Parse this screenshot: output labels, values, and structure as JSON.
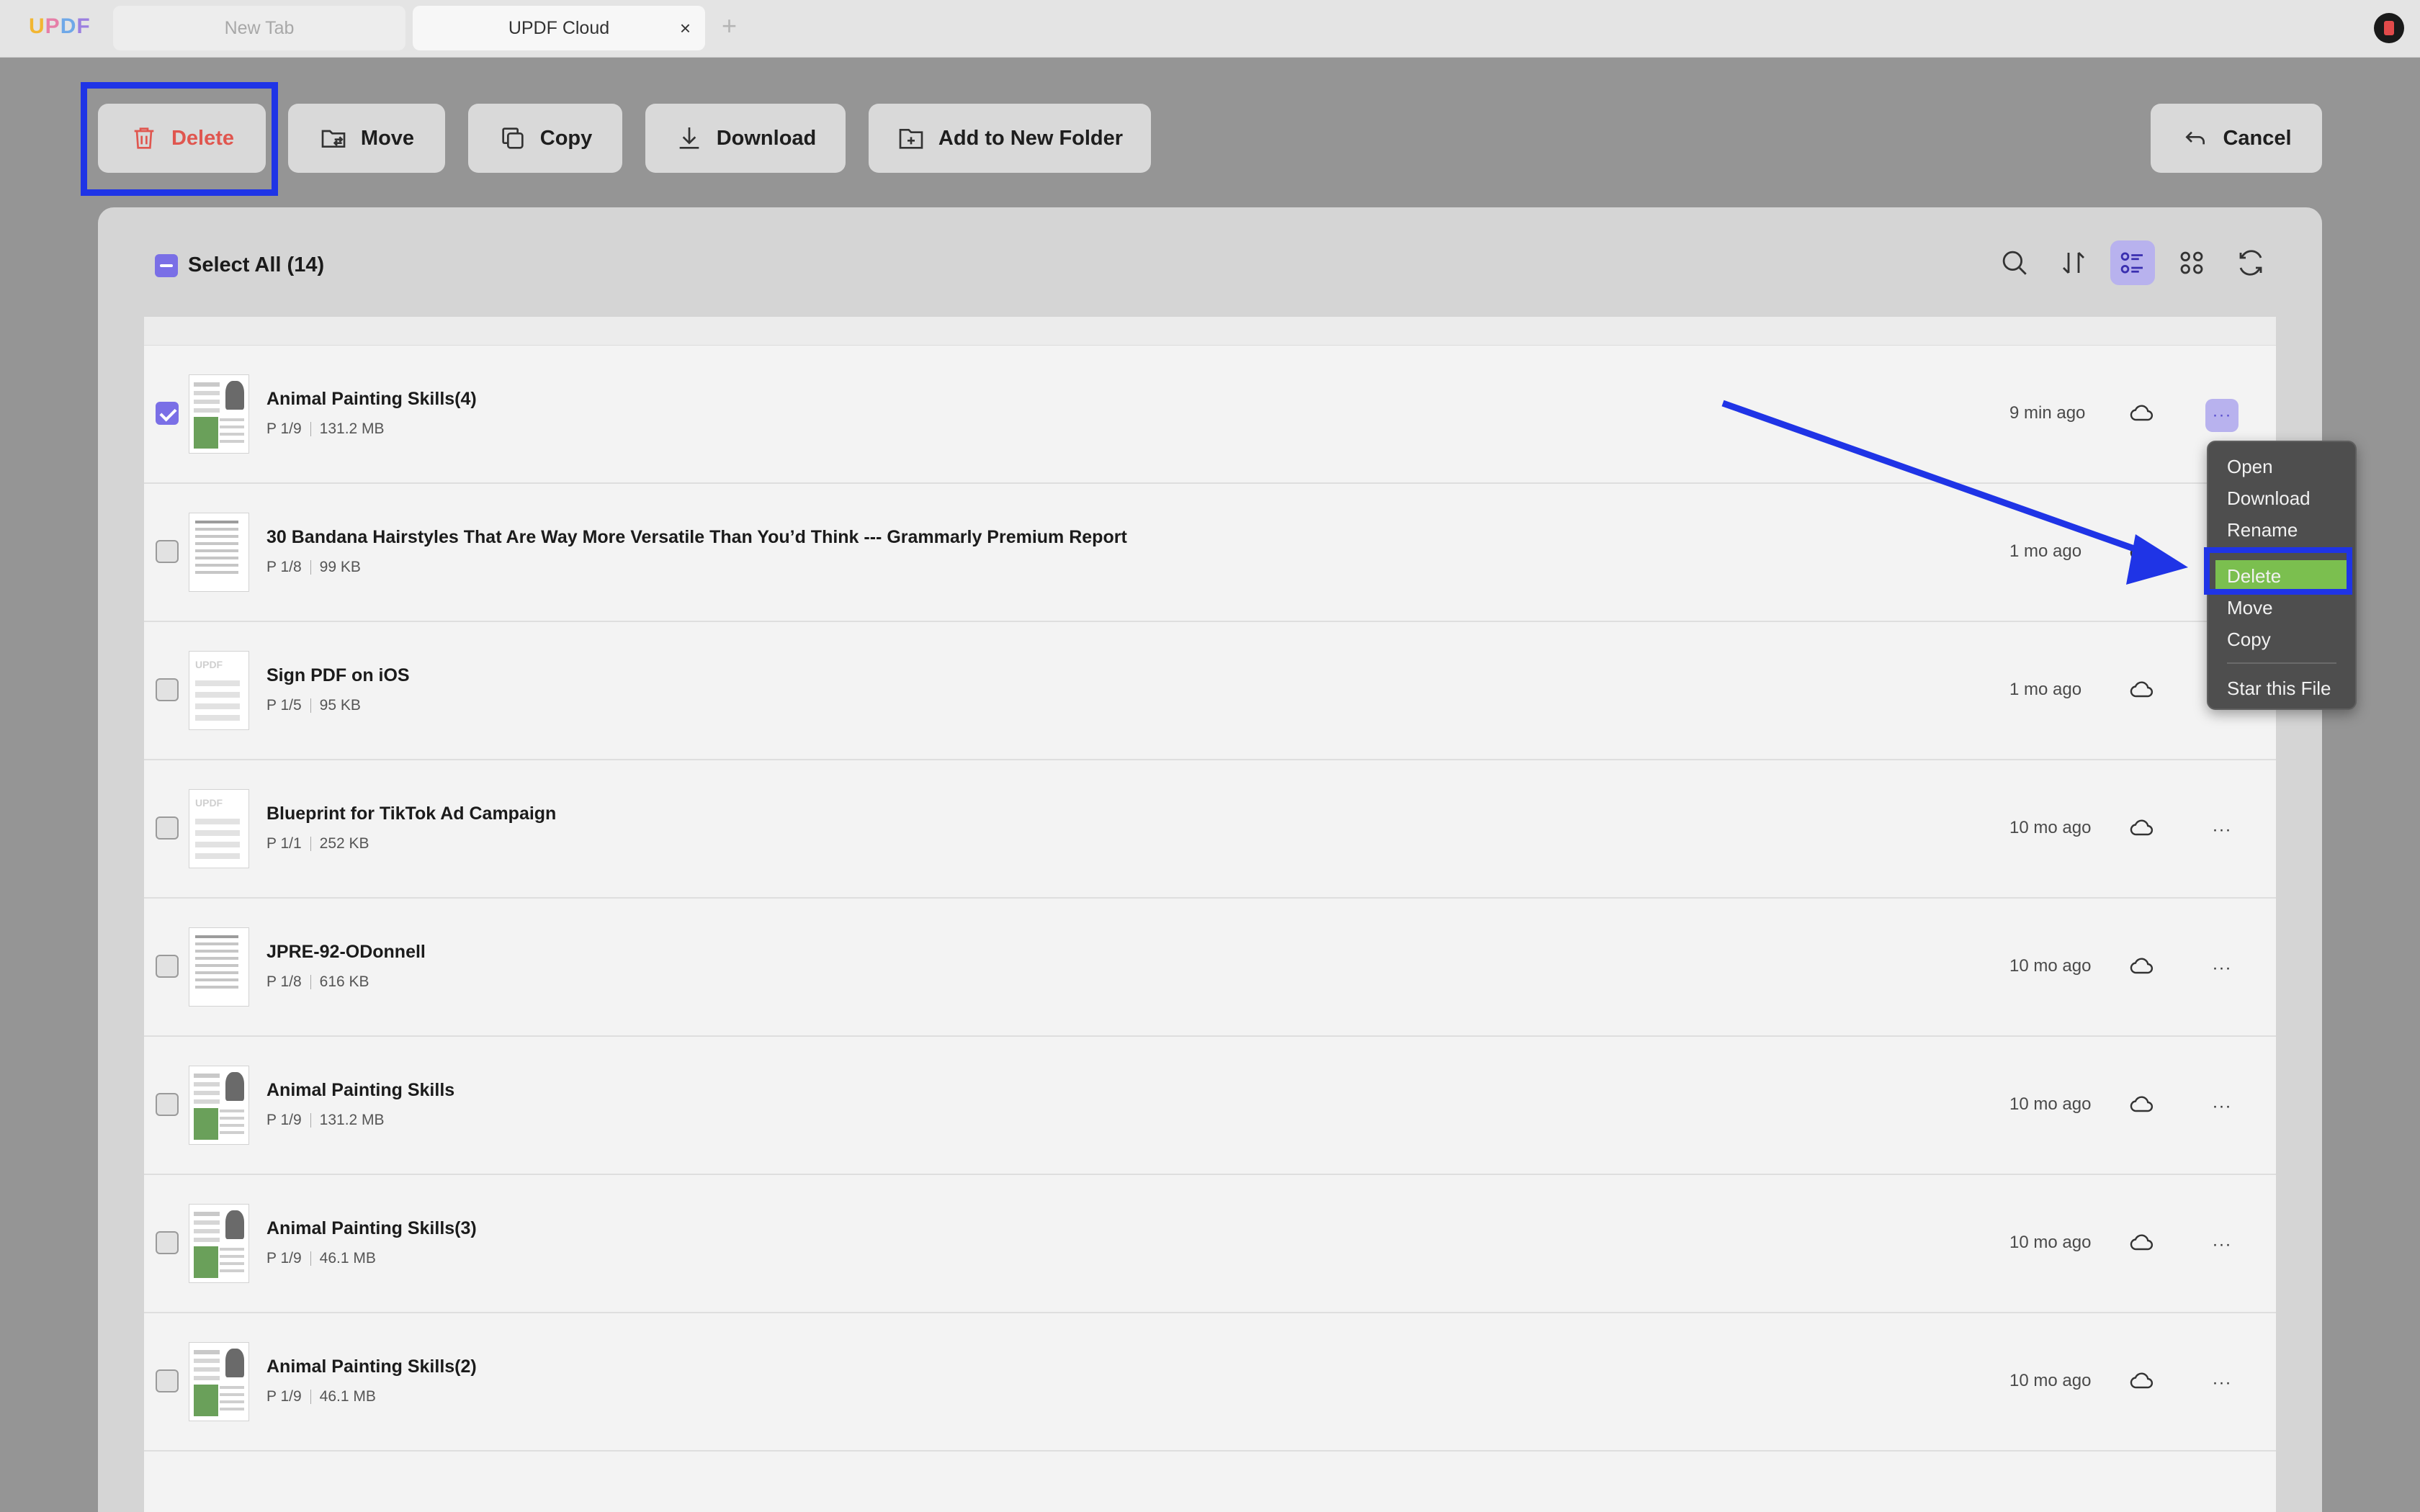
{
  "app": {
    "logo": "UPDF",
    "tabs": [
      {
        "label": "New Tab",
        "active": false
      },
      {
        "label": "UPDF Cloud",
        "active": true
      }
    ],
    "tab_close_glyph": "×",
    "tab_add_glyph": "+"
  },
  "toolbar": {
    "delete_label": "Delete",
    "move_label": "Move",
    "copy_label": "Copy",
    "download_label": "Download",
    "add_folder_label": "Add to New Folder",
    "cancel_label": "Cancel"
  },
  "panel": {
    "select_all_label": "Select All (14)"
  },
  "files": [
    {
      "name": "Animal Painting Skills(4)",
      "pages": "P 1/9",
      "size": "131.2 MB",
      "time": "9 min ago",
      "checked": true,
      "thumb": "art"
    },
    {
      "name": "30 Bandana Hairstyles That Are Way More Versatile Than You’d Think --- Grammarly Premium Report",
      "pages": "P 1/8",
      "size": "99 KB",
      "time": "1 mo ago",
      "checked": false,
      "thumb": "text"
    },
    {
      "name": "Sign PDF on iOS",
      "pages": "P 1/5",
      "size": "95 KB",
      "time": "1 mo ago",
      "checked": false,
      "thumb": "placeholder"
    },
    {
      "name": "Blueprint for TikTok Ad Campaign",
      "pages": "P 1/1",
      "size": "252 KB",
      "time": "10 mo ago",
      "checked": false,
      "thumb": "placeholder"
    },
    {
      "name": "JPRE-92-ODonnell",
      "pages": "P 1/8",
      "size": "616 KB",
      "time": "10 mo ago",
      "checked": false,
      "thumb": "text"
    },
    {
      "name": "Animal Painting Skills",
      "pages": "P 1/9",
      "size": "131.2 MB",
      "time": "10 mo ago",
      "checked": false,
      "thumb": "art"
    },
    {
      "name": "Animal Painting Skills(3)",
      "pages": "P 1/9",
      "size": "46.1 MB",
      "time": "10 mo ago",
      "checked": false,
      "thumb": "art"
    },
    {
      "name": "Animal Painting Skills(2)",
      "pages": "P 1/9",
      "size": "46.1 MB",
      "time": "10 mo ago",
      "checked": false,
      "thumb": "art"
    }
  ],
  "thumb_placeholder_text": "UPDF",
  "more_glyph": "···",
  "context_menu": {
    "items": [
      "Open",
      "Download",
      "Rename",
      "Delete",
      "Move",
      "Copy",
      "Star this File"
    ],
    "selected": "Delete"
  },
  "colors": {
    "accent": "#7a6fe6",
    "delete_red": "#e0564f",
    "menu_selected": "#7bbf4f",
    "annotation_blue": "#1f34e6"
  }
}
